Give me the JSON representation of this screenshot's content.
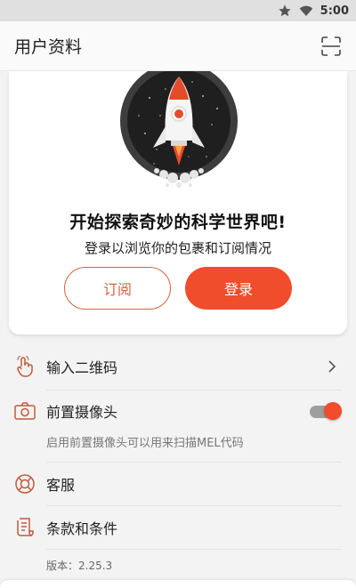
{
  "status_bar": {
    "time": "5:00"
  },
  "app_bar": {
    "title": "用户资料"
  },
  "promo_card": {
    "headline": "开始探索奇妙的科学世界吧!",
    "subtext": "登录以浏览你的包裹和订阅情况",
    "subscribe_label": "订阅",
    "login_label": "登录"
  },
  "menu": {
    "enter_code": "输入二维码",
    "front_camera": "前置摄像头",
    "front_camera_hint": "启用前置摄像头可以用来扫描MEL代码",
    "front_camera_enabled": true,
    "support": "客服",
    "terms": "条款和条件",
    "version": "版本：2.25.3"
  },
  "colors": {
    "accent": "#ef4d2b",
    "accent_outline": "#d6633f",
    "icon": "#c25a3c"
  }
}
